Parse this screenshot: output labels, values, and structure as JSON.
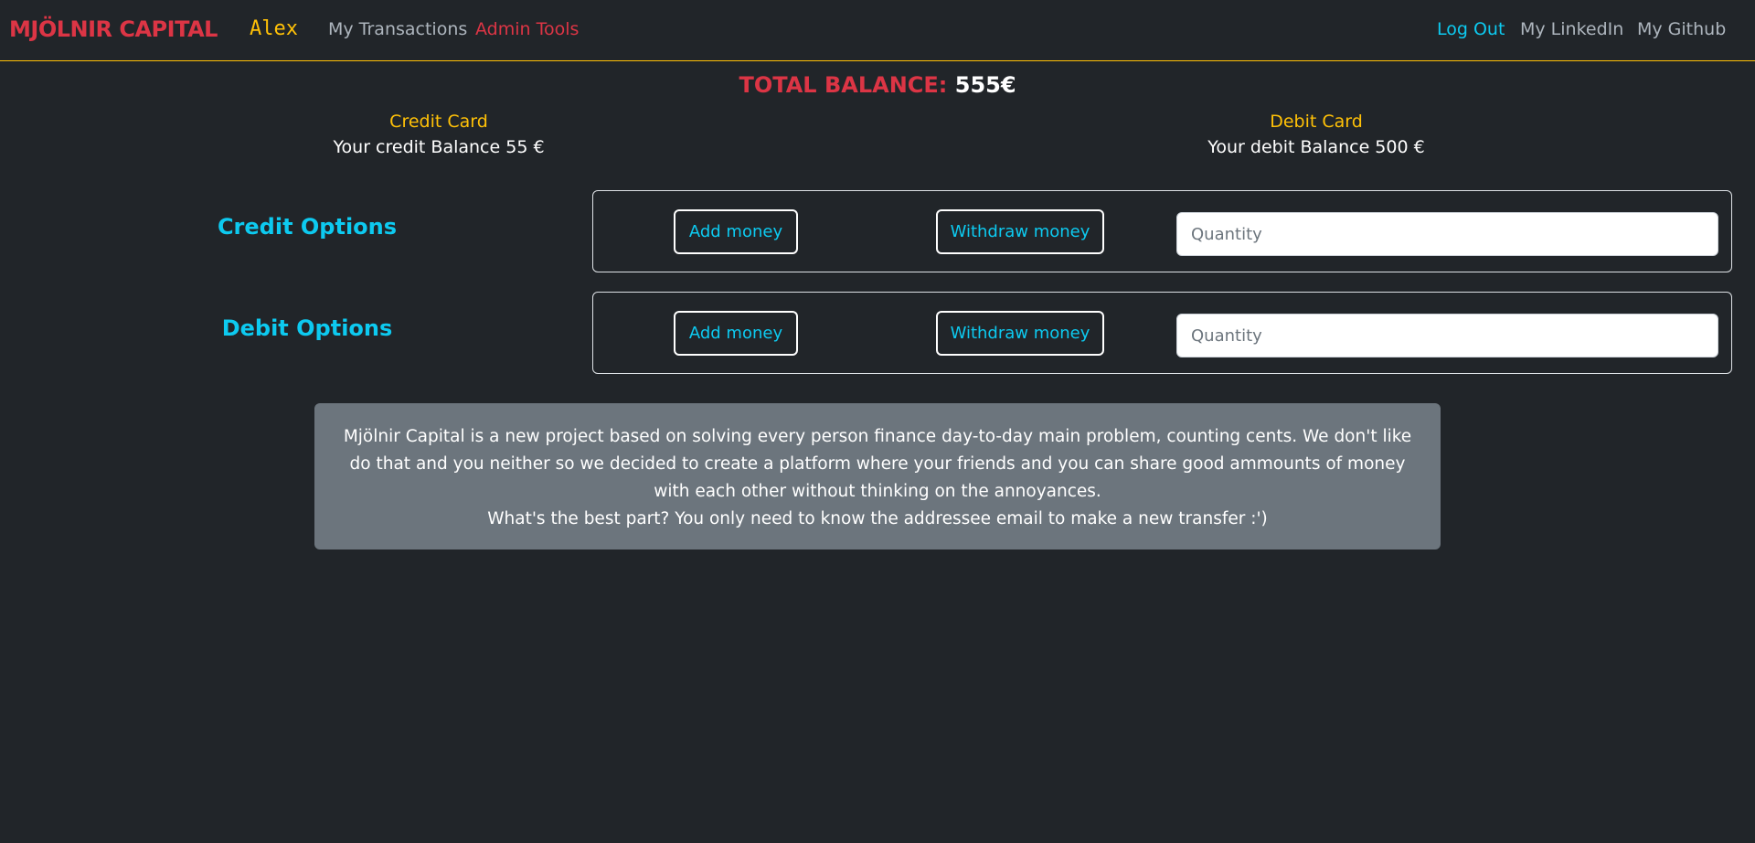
{
  "colors": {
    "background": "#212529",
    "brand_red": "#dc3545",
    "accent_yellow": "#ffc107",
    "accent_cyan": "#0dcaf0",
    "muted_gray": "#adb5bd",
    "panel_gray": "#6c757d"
  },
  "navbar": {
    "brand": "MJÖLNIR CAPITAL",
    "username": "Alex",
    "links_left": [
      "My Transactions",
      "Admin Tools"
    ],
    "links_right": [
      "Log Out",
      "My LinkedIn",
      "My Github"
    ]
  },
  "balance": {
    "total_label": "TOTAL BALANCE:",
    "total_value": "555€",
    "credit": {
      "title": "Credit Card",
      "text": "Your credit Balance 55 €"
    },
    "debit": {
      "title": "Debit Card",
      "text": "Your debit Balance 500 €"
    }
  },
  "options": {
    "credit": {
      "label": "Credit Options",
      "add_label": "Add money",
      "withdraw_label": "Withdraw money",
      "quantity_placeholder": "Quantity",
      "quantity_value": ""
    },
    "debit": {
      "label": "Debit Options",
      "add_label": "Add money",
      "withdraw_label": "Withdraw money",
      "quantity_placeholder": "Quantity",
      "quantity_value": ""
    }
  },
  "info": {
    "paragraph": "Mjölnir Capital is a new project based on solving every person finance day-to-day main problem, counting cents. We don't like do that and you neither so we decided to create a platform where your friends and you can share good ammounts of money with each other without thinking on the annoyances.",
    "highlight": "What's the best part? You only need to know the addressee email to make a new transfer :')"
  }
}
